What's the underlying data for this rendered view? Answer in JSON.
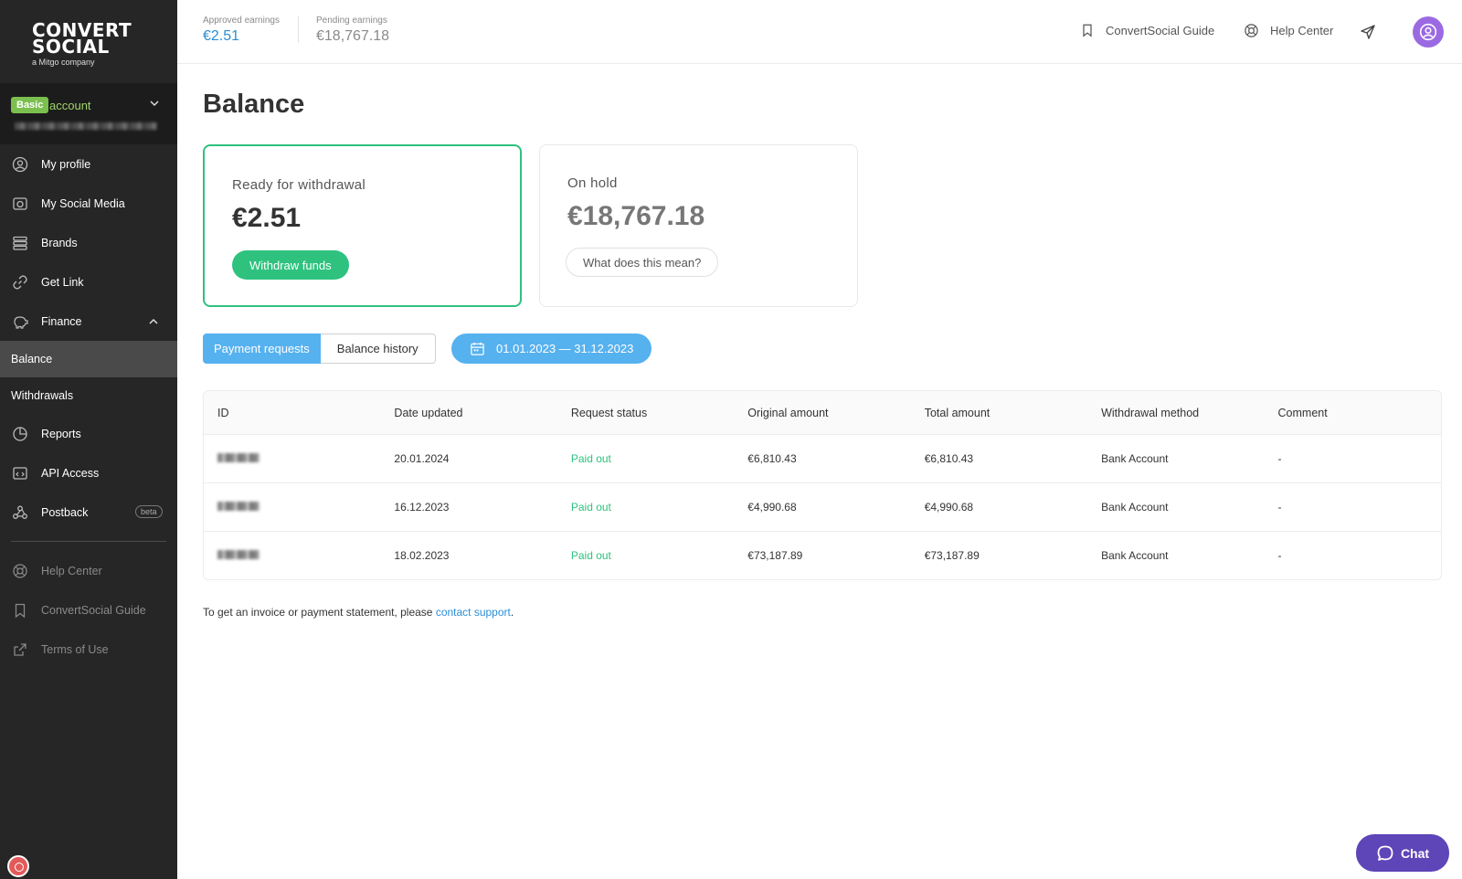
{
  "brand": {
    "line1": "CONVERT",
    "line2": "SOCIAL",
    "tagline": "a Mitgo company"
  },
  "account": {
    "plan_badge": "Basic",
    "label": "account"
  },
  "sidebar": {
    "items": [
      {
        "label": "My profile",
        "icon": "user-circle-icon"
      },
      {
        "label": "My Social Media",
        "icon": "camera-icon"
      },
      {
        "label": "Brands",
        "icon": "stack-icon"
      },
      {
        "label": "Get Link",
        "icon": "link-icon"
      },
      {
        "label": "Finance",
        "icon": "piggy-bank-icon"
      }
    ],
    "finance_sub": [
      {
        "label": "Balance",
        "active": true
      },
      {
        "label": "Withdrawals",
        "active": false
      }
    ],
    "items2": [
      {
        "label": "Reports",
        "icon": "pie-chart-icon"
      },
      {
        "label": "API Access",
        "icon": "code-icon"
      },
      {
        "label": "Postback",
        "icon": "webhook-icon",
        "badge": "beta"
      }
    ],
    "footer_links": [
      {
        "label": "Help Center",
        "icon": "lifebuoy-icon"
      },
      {
        "label": "ConvertSocial Guide",
        "icon": "bookmark-icon"
      },
      {
        "label": "Terms of Use",
        "icon": "external-link-icon"
      }
    ]
  },
  "header": {
    "approved_label": "Approved earnings",
    "approved_value": "€2.51",
    "pending_label": "Pending earnings",
    "pending_value": "€18,767.18",
    "guide_link": "ConvertSocial Guide",
    "help_link": "Help Center"
  },
  "page": {
    "title": "Balance"
  },
  "cards": {
    "ready": {
      "label": "Ready for withdrawal",
      "amount": "€2.51",
      "button": "Withdraw funds"
    },
    "hold": {
      "label": "On hold",
      "amount": "€18,767.18",
      "button": "What does this mean?"
    }
  },
  "tabs": {
    "payment_requests": "Payment requests",
    "balance_history": "Balance history"
  },
  "date_range": "01.01.2023 — 31.12.2023",
  "table": {
    "headers": [
      "ID",
      "Date updated",
      "Request status",
      "Original amount",
      "Total amount",
      "Withdrawal method",
      "Comment"
    ],
    "rows": [
      {
        "date": "20.01.2024",
        "status": "Paid out",
        "original": "€6,810.43",
        "total": "€6,810.43",
        "method": "Bank Account",
        "comment": "-"
      },
      {
        "date": "16.12.2023",
        "status": "Paid out",
        "original": "€4,990.68",
        "total": "€4,990.68",
        "method": "Bank Account",
        "comment": "-"
      },
      {
        "date": "18.02.2023",
        "status": "Paid out",
        "original": "€73,187.89",
        "total": "€73,187.89",
        "method": "Bank Account",
        "comment": "-"
      }
    ]
  },
  "footnote": {
    "text": "To get an invoice or payment statement, please ",
    "link": "contact support",
    "end": "."
  },
  "chat": {
    "label": "Chat"
  },
  "colors": {
    "sidebar_bg": "#262626",
    "accent_green": "#2ec27e",
    "accent_blue": "#56b1ef",
    "link_blue": "#2b8ed6",
    "avatar_purple": "#9b6ae2",
    "chat_purple": "#5e45b8"
  }
}
